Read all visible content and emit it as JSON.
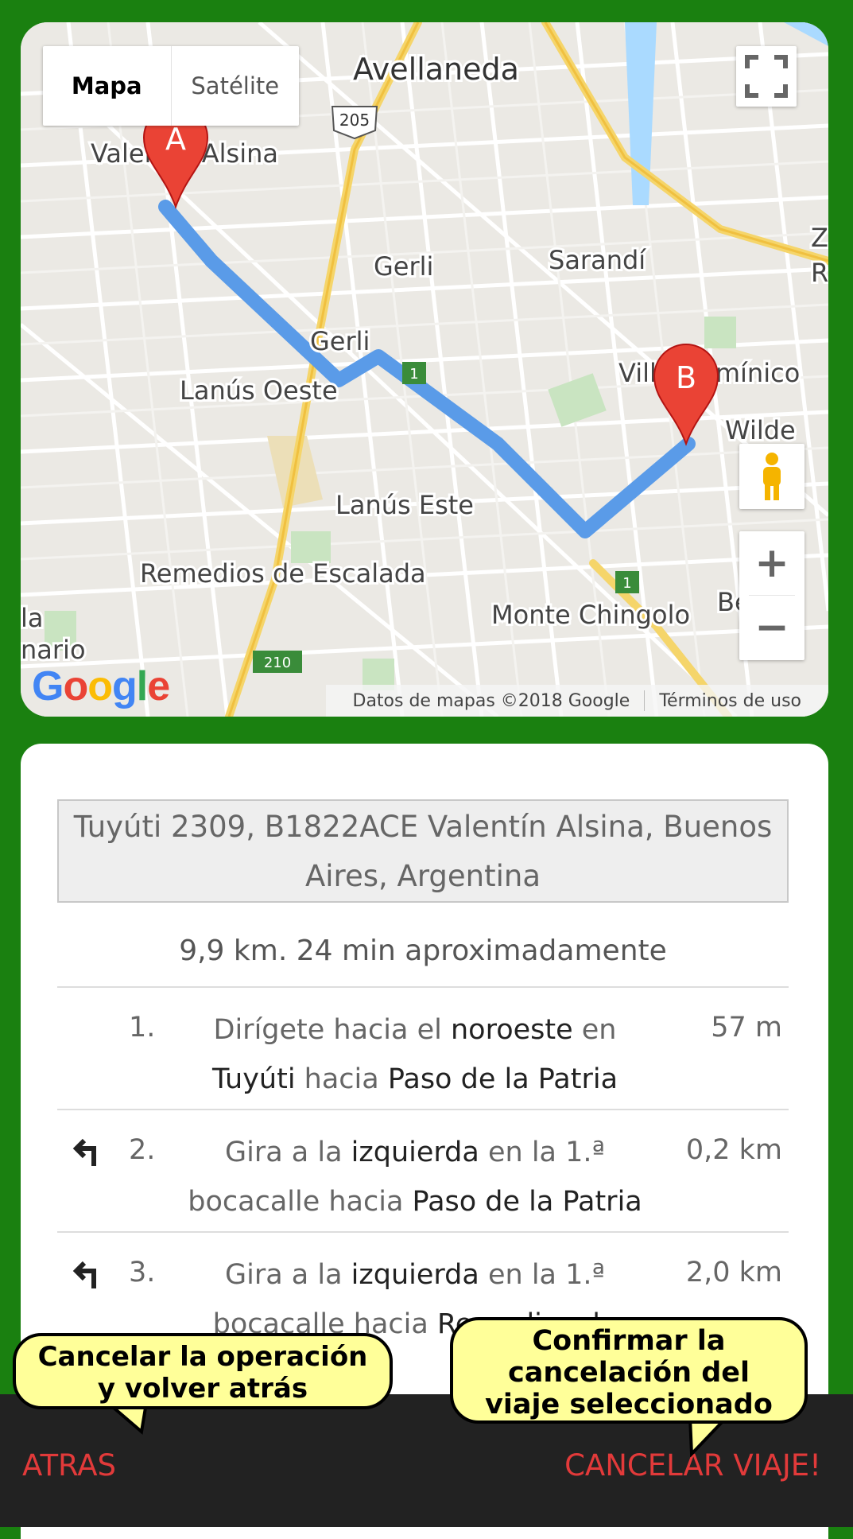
{
  "map": {
    "type_map_label": "Mapa",
    "type_satellite_label": "Satélite",
    "place_labels": [
      "Avellaneda",
      "Valentín Alsina",
      "Gerli",
      "Gerli",
      "Sarandí",
      "Lanús Oeste",
      "Villa Domínico",
      "Wilde",
      "Lanús Este",
      "Remedios de Escalada",
      "Monte Chingolo",
      "Bernal",
      "la",
      "nario",
      "Z",
      "R"
    ],
    "road_shields": [
      "205",
      "1",
      "1",
      "210"
    ],
    "marker_a": "A",
    "marker_b": "B",
    "footer_data": "Datos de mapas ©2018 Google",
    "footer_terms": "Términos de uso",
    "zoom_in": "+",
    "zoom_out": "−",
    "route_color": "#5a9be8"
  },
  "route": {
    "address": "Tuyúti 2309, B1822ACE Valentín Alsina, Buenos Aires, Argentina",
    "summary": "9,9 km. 24 min aproximadamente",
    "steps": [
      {
        "num": "1.",
        "pre": "Dirígete hacia el ",
        "b1": "noroeste",
        "mid": " en ",
        "b2": "Tuyúti",
        "mid2": " hacia ",
        "b3": "Paso de la Patria",
        "dist": "57 m",
        "icon": ""
      },
      {
        "num": "2.",
        "pre": "Gira a la ",
        "b1": "izquierda",
        "mid": " en la 1.ª bocacalle hacia ",
        "b2": "Paso de la Patria",
        "dist": "0,2 km",
        "icon": "turn-left-icon"
      },
      {
        "num": "3.",
        "pre": "Gira a la ",
        "b1": "izquierda",
        "mid": " en la 1.ª bocacalle hacia ",
        "b2": "Remedios de",
        "dist": "2,0 km",
        "icon": "turn-left-icon"
      }
    ]
  },
  "bottom": {
    "back_label": "ATRAS",
    "cancel_label": "CANCELAR VIAJE!"
  },
  "callouts": {
    "left_line1": "Cancelar la operación",
    "left_line2": "y volver atrás",
    "right_line1": "Confirmar la",
    "right_line2": "cancelación del",
    "right_line3": "viaje seleccionado"
  },
  "colors": {
    "background": "#1a8010",
    "bottom_bar": "#222222",
    "action_text": "#e23a3a",
    "callout_fill": "#ffff99"
  }
}
